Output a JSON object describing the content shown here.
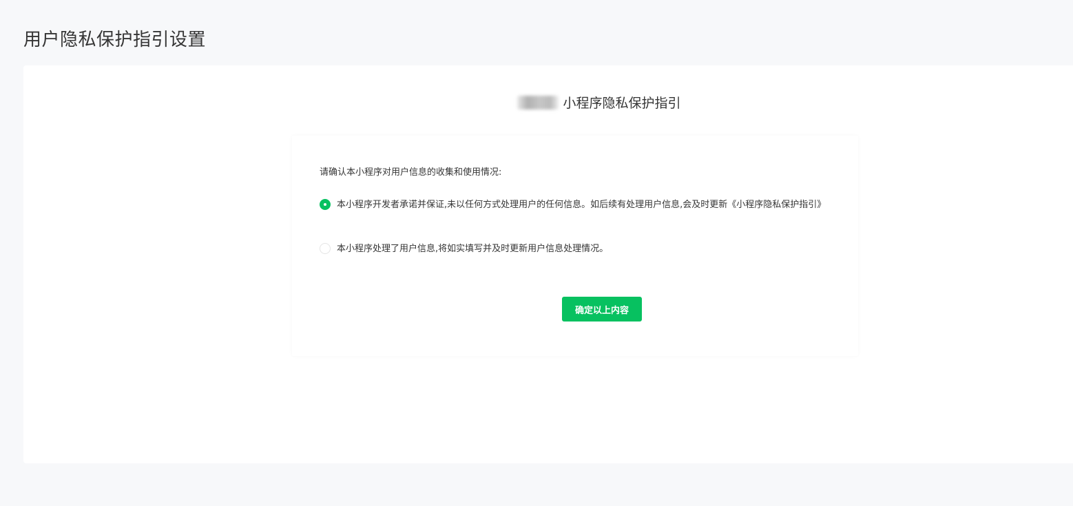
{
  "page": {
    "title": "用户隐私保护指引设置"
  },
  "guide": {
    "heading": "小程序隐私保护指引",
    "prompt": "请确认本小程序对用户信息的收集和使用情况:",
    "options": [
      {
        "label": "本小程序开发者承诺并保证,未以任何方式处理用户的任何信息。如后续有处理用户信息,会及时更新《小程序隐私保护指引》",
        "selected": true
      },
      {
        "label": "本小程序处理了用户信息,将如实填写并及时更新用户信息处理情况。",
        "selected": false
      }
    ],
    "confirm_label": "确定以上内容"
  },
  "colors": {
    "accent": "#07c160",
    "background": "#f7f8fa",
    "card": "#ffffff",
    "text": "#353535"
  }
}
